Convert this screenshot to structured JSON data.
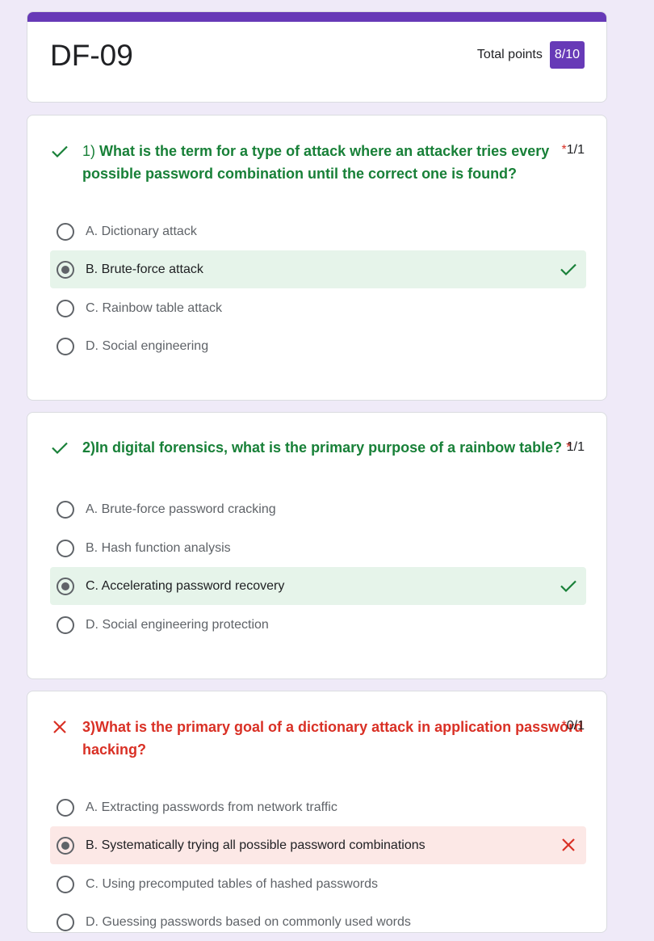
{
  "form": {
    "title": "DF-09",
    "total_points_label": "Total points",
    "total_points_value": "8/10"
  },
  "questions": [
    {
      "number": "1)",
      "text_line1": "What is the term for a type of attack where an attacker tries every",
      "text_line2": "possible password combination until the correct one is found?",
      "required": "*",
      "score": "1/1",
      "status": "correct",
      "options": [
        {
          "label": "A. Dictionary attack",
          "selected": false
        },
        {
          "label": "B. Brute-force attack",
          "selected": true,
          "result": "correct"
        },
        {
          "label": "C. Rainbow table attack",
          "selected": false
        },
        {
          "label": "D. Social engineering",
          "selected": false
        }
      ]
    },
    {
      "number": "2)",
      "text_line1": "In digital forensics, what is the primary purpose of a rainbow table?",
      "required": "*",
      "score": "1/1",
      "status": "correct",
      "options": [
        {
          "label": "A. Brute-force password cracking",
          "selected": false
        },
        {
          "label": "B. Hash function analysis",
          "selected": false
        },
        {
          "label": "C. Accelerating password recovery",
          "selected": true,
          "result": "correct"
        },
        {
          "label": "D. Social engineering protection",
          "selected": false
        }
      ]
    },
    {
      "number": "3)",
      "text_line1": "What is the primary goal of a dictionary attack in application password",
      "text_line2": "hacking?",
      "required": "*",
      "score": "0/1",
      "status": "wrong",
      "options": [
        {
          "label": "A. Extracting passwords from network traffic",
          "selected": false
        },
        {
          "label": "B. Systematically trying all possible password combinations",
          "selected": true,
          "result": "wrong"
        },
        {
          "label": "C. Using precomputed tables of hashed passwords",
          "selected": false
        },
        {
          "label": "D. Guessing passwords based on commonly used words",
          "selected": false
        }
      ]
    }
  ],
  "colors": {
    "accent": "#673ab7",
    "correct": "#188038",
    "wrong": "#d93025",
    "correct_bg": "#e6f4ea",
    "wrong_bg": "#fce8e6"
  },
  "icons": {
    "correct": "check-icon",
    "wrong": "cross-icon"
  }
}
